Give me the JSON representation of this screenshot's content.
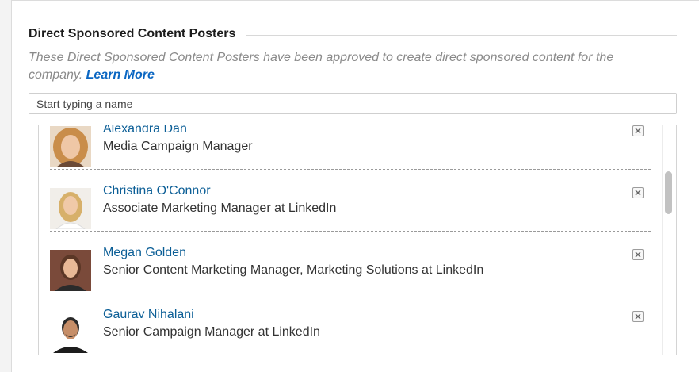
{
  "section": {
    "title": "Direct Sponsored Content Posters",
    "description": "These Direct Sponsored Content Posters have been approved to create direct sponsored content for the company.",
    "learn_more_label": "Learn More"
  },
  "search": {
    "placeholder": "Start typing a name"
  },
  "posters": [
    {
      "name": "Alexandra Dan",
      "title": "Media Campaign Manager",
      "avatar_icon": "person-photo-icon"
    },
    {
      "name": "Christina O'Connor",
      "title": "Associate Marketing Manager at LinkedIn",
      "avatar_icon": "person-photo-icon"
    },
    {
      "name": "Megan Golden",
      "title": "Senior Content Marketing Manager, Marketing Solutions at LinkedIn",
      "avatar_icon": "person-photo-icon"
    },
    {
      "name": "Gaurav Nihalani",
      "title": "Senior Campaign Manager at LinkedIn",
      "avatar_icon": "person-photo-icon"
    }
  ],
  "icons": {
    "remove": "close-icon"
  },
  "colors": {
    "link": "#0b5e96",
    "learn_more": "#0a66c2",
    "description": "#8a8a8a"
  }
}
